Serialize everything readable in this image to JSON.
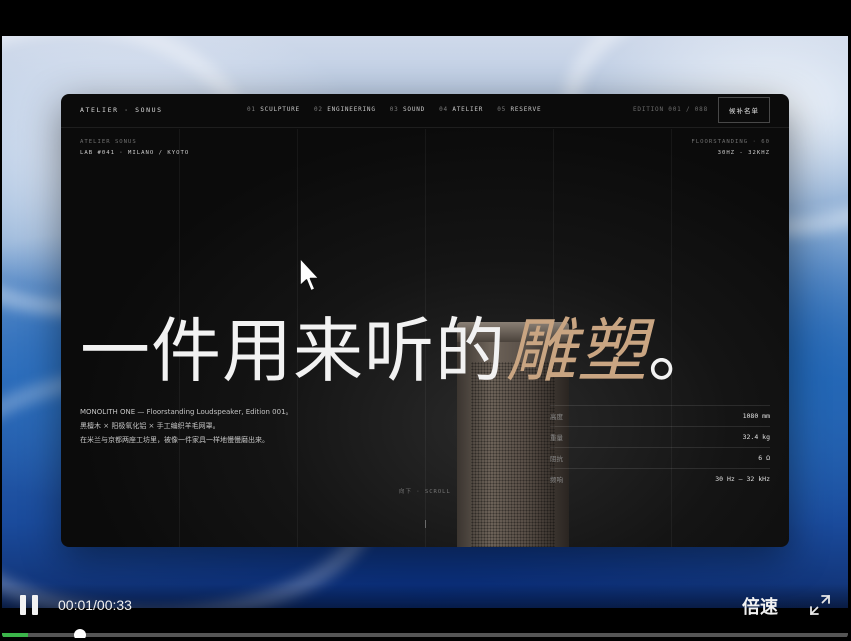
{
  "player": {
    "time_display": "00:01/00:33",
    "speed_label": "倍速",
    "progress": 0.0303,
    "accent_color": "#3bb54a"
  },
  "site": {
    "brand": "ATELIER · SONUS",
    "nav": [
      {
        "num": "01",
        "label": "SCULPTURE"
      },
      {
        "num": "02",
        "label": "ENGINEERING"
      },
      {
        "num": "03",
        "label": "SOUND"
      },
      {
        "num": "04",
        "label": "ATELIER"
      },
      {
        "num": "05",
        "label": "RESERVE"
      }
    ],
    "edition": "EDITION 001 / 088",
    "cta_label": "候补名单",
    "meta_left": {
      "line1": "ATELIER SONUS",
      "line2": "LAB #041 · MILANO / KYOTO"
    },
    "meta_right": {
      "line1": "FLOORSTANDING · 60",
      "line2": "30HZ - 32KHZ"
    },
    "headline_main": "一件用来听的",
    "headline_accent": "雕塑",
    "headline_end": "。",
    "description": [
      "MONOLITH ONE — Floorstanding Loudspeaker, Edition 001。",
      "黑檀木 × 阳极氧化铝 × 手工编织羊毛网罩。",
      "在米兰与京都两座工坊里，被像一件家具一样地慢慢磨出来。"
    ],
    "specs": [
      {
        "key": "高度",
        "value": "1080 mm"
      },
      {
        "key": "重量",
        "value": "32.4 kg"
      },
      {
        "key": "阻抗",
        "value": "6 Ω"
      },
      {
        "key": "频响",
        "value": "30 Hz – 32 kHz"
      }
    ],
    "scroll_hint": "向下 · SCROLL",
    "accent_color": "#c9a582"
  }
}
